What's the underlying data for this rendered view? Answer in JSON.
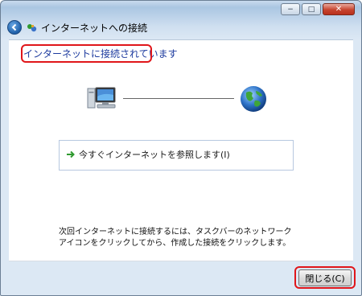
{
  "window": {
    "title": "インターネットへの接続",
    "caption_buttons": {
      "minimize": "−",
      "maximize": "□",
      "close": "✕"
    }
  },
  "main": {
    "status_heading": "インターネットに接続されています",
    "option_label": "今すぐインターネットを参照します(I)",
    "info_line1": "次回インターネットに接続するには、タスクバーのネットワーク",
    "info_line2": "アイコンをクリックしてから、作成した接続をクリックします。"
  },
  "footer": {
    "close_label": "閉じる(C)"
  },
  "icons": [
    "back-arrow-icon",
    "network-icon",
    "computer-icon",
    "globe-icon",
    "green-arrow-icon"
  ],
  "colors": {
    "highlight": "#e0161a",
    "heading": "#1c3a9e",
    "accent_green": "#2f9a2f"
  }
}
